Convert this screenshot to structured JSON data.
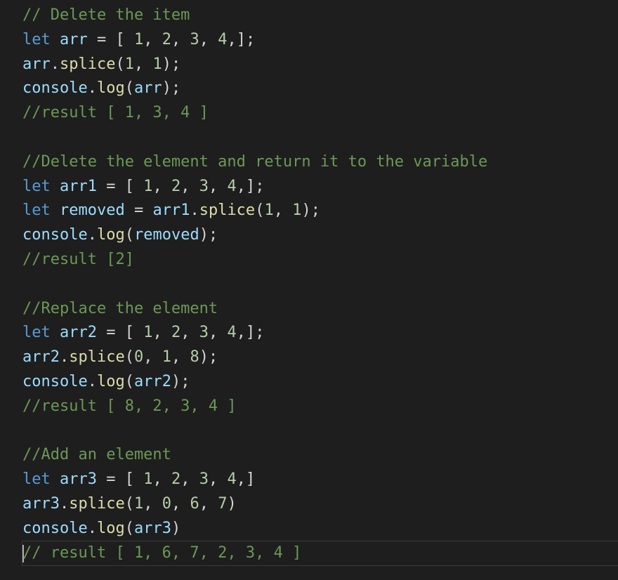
{
  "colors": {
    "background": "#1e1e1e",
    "comment": "#6a9955",
    "keyword": "#569cd6",
    "variable": "#9cdcfe",
    "number": "#b5cea8",
    "function": "#dcdcaa",
    "text": "#d4d4d4"
  },
  "code": {
    "lines": [
      {
        "kind": "comment",
        "text": "// Delete the item"
      },
      {
        "kind": "code",
        "text": "let arr = [ 1, 2, 3, 4,];"
      },
      {
        "kind": "code",
        "text": "arr.splice(1, 1);"
      },
      {
        "kind": "code",
        "text": "console.log(arr);"
      },
      {
        "kind": "comment",
        "text": "//result [ 1, 3, 4 ]"
      },
      {
        "kind": "blank",
        "text": ""
      },
      {
        "kind": "comment",
        "text": "//Delete the element and return it to the variable"
      },
      {
        "kind": "code",
        "text": "let arr1 = [ 1, 2, 3, 4,];"
      },
      {
        "kind": "code",
        "text": "let removed = arr1.splice(1, 1);"
      },
      {
        "kind": "code",
        "text": "console.log(removed);"
      },
      {
        "kind": "comment",
        "text": "//result [2]"
      },
      {
        "kind": "blank",
        "text": ""
      },
      {
        "kind": "comment",
        "text": "//Replace the element"
      },
      {
        "kind": "code",
        "text": "let arr2 = [ 1, 2, 3, 4,];"
      },
      {
        "kind": "code",
        "text": "arr2.splice(0, 1, 8);"
      },
      {
        "kind": "code",
        "text": "console.log(arr2);"
      },
      {
        "kind": "comment",
        "text": "//result [ 8, 2, 3, 4 ]"
      },
      {
        "kind": "blank",
        "text": ""
      },
      {
        "kind": "comment",
        "text": "//Add an element"
      },
      {
        "kind": "code",
        "text": "let arr3 = [ 1, 2, 3, 4,]"
      },
      {
        "kind": "code",
        "text": "arr3.splice(1, 0, 6, 7)"
      },
      {
        "kind": "code",
        "text": "console.log(arr3)"
      },
      {
        "kind": "comment",
        "text": "// result [ 1, 6, 7, 2, 3, 4 ]",
        "active": true
      }
    ]
  }
}
